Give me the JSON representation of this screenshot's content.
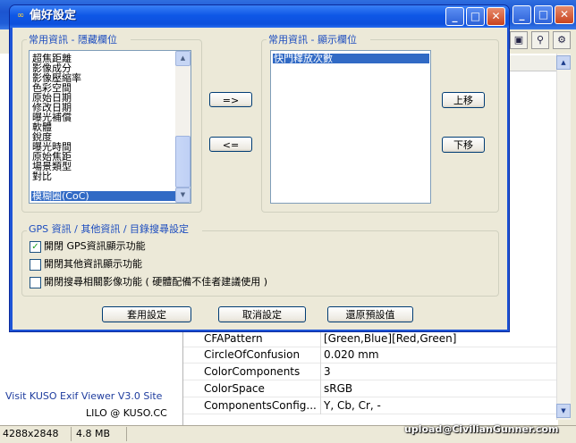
{
  "background_app": {
    "grid_rows": [
      {
        "name": "CFAPattern",
        "value": "[Green,Blue][Red,Green]"
      },
      {
        "name": "CircleOfConfusion",
        "value": "0.020 mm"
      },
      {
        "name": "ColorComponents",
        "value": "3"
      },
      {
        "name": "ColorSpace",
        "value": "sRGB"
      },
      {
        "name": "ComponentsConfig...",
        "value": "Y, Cb, Cr, -"
      }
    ],
    "footer_link": "Visit KUSO Exif Viewer V3.0 Site",
    "footer_credit": "LILO @ KUSO.CC",
    "status": {
      "dimensions": "4288x2848",
      "size": "4.8 MB"
    },
    "watermark": "upload@CivilianGunner.com"
  },
  "dialog": {
    "title": "偏好設定",
    "hidden_group_label": "常用資訊 - 隱藏欄位",
    "visible_group_label": "常用資訊 - 顯示欄位",
    "hidden_items": [
      "超焦距離",
      "影像成分",
      "影像壓縮率",
      "色彩空間",
      "原始日期",
      "修改日期",
      "曝光補償",
      "軟體",
      "銳度",
      "曝光時間",
      "原始焦距",
      "場景類型",
      "對比",
      "模糊圈(CoC)"
    ],
    "hidden_selected": "模糊圈(CoC)",
    "visible_items": [
      "快門釋放次數"
    ],
    "add_label": "=>",
    "remove_label": "<=",
    "move_up_label": "上移",
    "move_down_label": "下移",
    "gps_group_label": "GPS 資訊 / 其他資訊 / 目錄搜尋設定",
    "checkboxes": [
      {
        "label": "開閉 GPS資訊顯示功能",
        "checked": true
      },
      {
        "label": "開閉其他資訊顯示功能",
        "checked": false
      },
      {
        "label": "開閉搜尋相關影像功能 ( 硬體配備不佳者建議使用 )",
        "checked": false
      }
    ],
    "apply_label": "套用設定",
    "cancel_label": "取消設定",
    "reset_label": "還原預設值"
  },
  "colors": {
    "selection": "#316ac5",
    "title_bar": "#0d50dc",
    "group_label": "#1d4dbf"
  }
}
